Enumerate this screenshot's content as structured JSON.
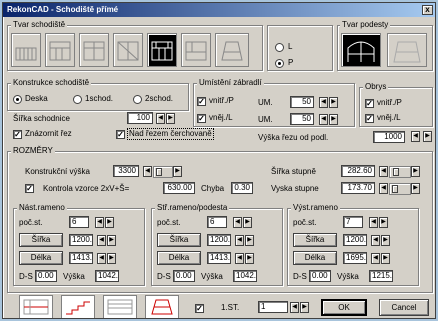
{
  "title": "RekonCAD - Schodiště přímé",
  "close": "x",
  "tvar_schodiste": {
    "label": "Tvar schodiště"
  },
  "orientation": {
    "l": "L",
    "p": "P",
    "selected": "P"
  },
  "tvar_podesty": {
    "label": "Tvar podesty"
  },
  "konstrukce": {
    "label": "Konstrukce schodiště",
    "options": [
      "Deska",
      "1schod.",
      "2schod."
    ],
    "selected": "Deska"
  },
  "sirka_schodnice": {
    "label": "Šířka schodnice",
    "value": "100"
  },
  "znazornit_rez": {
    "label": "Znázornit řez",
    "checked": true
  },
  "nad_rezem": {
    "label": "Nad řezem čerchovaně",
    "checked": true
  },
  "zabradli": {
    "label": "Umístění zábradlí",
    "vnitr": "vnitř./P",
    "vnej": "vněj./L",
    "um": "UM.",
    "vnitr_um": "50",
    "vnej_um": "50"
  },
  "obrys": {
    "label": "Obrys",
    "vnitr": "vnitř./P",
    "vnej": "vněj./L"
  },
  "vyska_rezu": {
    "label": "Výška řezu od podl.",
    "value": "1000"
  },
  "rozmery": {
    "label": "ROZMĚRY",
    "konstrukcni_vyska_label": "Konstrukční výška",
    "konstrukcni_vyska": "3300",
    "sirka_stupne_label": "Šířka stupně",
    "sirka_stupne": "282.60",
    "kontrola_label": "Kontrola vzorce 2xV+Š=",
    "kontrola": "630.00",
    "chyba_label": "Chyba",
    "chyba": "0.30",
    "vyska_stupne_label": "Vyska stupne",
    "vyska_stupne": "173.70"
  },
  "ramena": [
    {
      "label": "Nást.rameno",
      "poc_label": "poč.st.",
      "poc": "6",
      "sirka_btn": "Šířka",
      "sirka": "1200.",
      "delka_btn": "Délka",
      "delka": "1413.",
      "ds_label": "D-S",
      "ds": "0.00",
      "vyska_label": "Výška",
      "vyska": "1042."
    },
    {
      "label": "Stř.rameno/podesta",
      "poc_label": "poč.st.",
      "poc": "6",
      "sirka_btn": "Šířka",
      "sirka": "1200.",
      "delka_btn": "Délka",
      "delka": "1413.",
      "ds_label": "D-S",
      "ds": "0.00",
      "vyska_label": "Výška",
      "vyska": "1042."
    },
    {
      "label": "Výst.rameno",
      "poc_label": "poč.st.",
      "poc": "7",
      "sirka_btn": "Šířka",
      "sirka": "1200.",
      "delka_btn": "Délka",
      "delka": "1695.",
      "ds_label": "D-S",
      "ds": "0.00",
      "vyska_label": "Výška",
      "vyska": "1215."
    }
  ],
  "bottom": {
    "st_label": "1.ST.",
    "st_value": "1",
    "ok": "OK",
    "cancel": "Cancel"
  }
}
